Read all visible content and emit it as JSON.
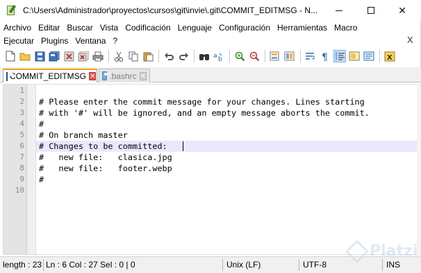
{
  "window": {
    "title": "C:\\Users\\Administrador\\proyectos\\cursos\\git\\invie\\.git\\COMMIT_EDITMSG - N...",
    "minimize": "",
    "maximize": "",
    "close": "✕"
  },
  "menu": {
    "row1": [
      "Archivo",
      "Editar",
      "Buscar",
      "Vista",
      "Codificación",
      "Lenguaje",
      "Configuración",
      "Herramientas",
      "Macro"
    ],
    "row2": [
      "Ejecutar",
      "Plugins",
      "Ventana",
      "?"
    ],
    "close_doc": "X"
  },
  "toolbar": {
    "icons": [
      "new-file-icon",
      "open-file-icon",
      "save-icon",
      "save-all-icon",
      "close-icon",
      "close-all-icon",
      "print-icon",
      "cut-icon",
      "copy-icon",
      "paste-icon",
      "undo-icon",
      "redo-icon",
      "find-icon",
      "replace-icon",
      "zoom-in-icon",
      "zoom-out-icon",
      "sync-vertical-icon",
      "sync-horizontal-icon",
      "word-wrap-icon",
      "show-all-chars-icon",
      "indent-guide-icon",
      "document-map-icon",
      "function-list-icon",
      "macro-icon"
    ]
  },
  "tabs": [
    {
      "label": "COMMIT_EDITMSG",
      "active": true
    },
    {
      "label": ".bashrc",
      "active": false
    }
  ],
  "editor": {
    "lines": [
      {
        "num": "1",
        "text": ""
      },
      {
        "num": "2",
        "text": "# Please enter the commit message for your changes. Lines starting"
      },
      {
        "num": "3",
        "text": "# with '#' will be ignored, and an empty message aborts the commit."
      },
      {
        "num": "4",
        "text": "#"
      },
      {
        "num": "5",
        "text": "# On branch master"
      },
      {
        "num": "6",
        "text": "# Changes to be committed:"
      },
      {
        "num": "7",
        "text": "#   new file:   clasica.jpg"
      },
      {
        "num": "8",
        "text": "#   new file:   footer.webp"
      },
      {
        "num": "9",
        "text": "#"
      },
      {
        "num": "10",
        "text": ""
      }
    ],
    "current_line": 6
  },
  "status": {
    "length": "length : 23",
    "position": "Ln : 6    Col : 27    Sel : 0 | 0",
    "eol": "Unix (LF)",
    "encoding": "UTF-8",
    "mode": "INS"
  },
  "watermark": "Platzi"
}
